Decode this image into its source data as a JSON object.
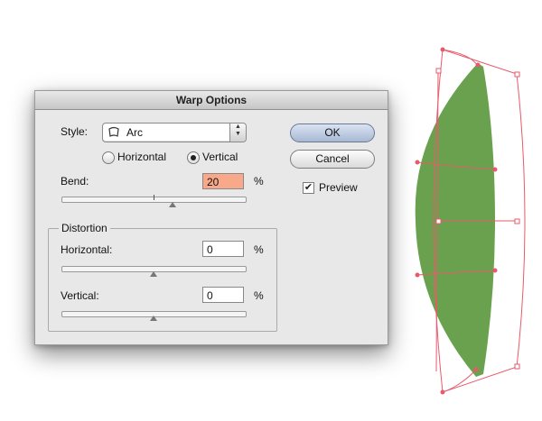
{
  "dialog": {
    "title": "Warp Options",
    "style_label": "Style:",
    "style_value": "Arc",
    "style_icon": "arc-warp-icon",
    "orientation": {
      "horizontal_label": "Horizontal",
      "vertical_label": "Vertical",
      "selected": "Vertical"
    },
    "bend": {
      "label": "Bend:",
      "value": "20",
      "unit": "%",
      "slider_fraction": 0.6
    },
    "distortion": {
      "title": "Distortion",
      "horizontal": {
        "label": "Horizontal:",
        "value": "0",
        "unit": "%",
        "slider_fraction": 0.5
      },
      "vertical": {
        "label": "Vertical:",
        "value": "0",
        "unit": "%",
        "slider_fraction": 0.5
      }
    },
    "buttons": {
      "ok": "OK",
      "cancel": "Cancel"
    },
    "preview": {
      "label": "Preview",
      "checked": true
    },
    "highlight_color": "#f8a98a"
  },
  "artwork": {
    "fill_color": "#6aa14e",
    "guide_color": "#e85a6a"
  }
}
